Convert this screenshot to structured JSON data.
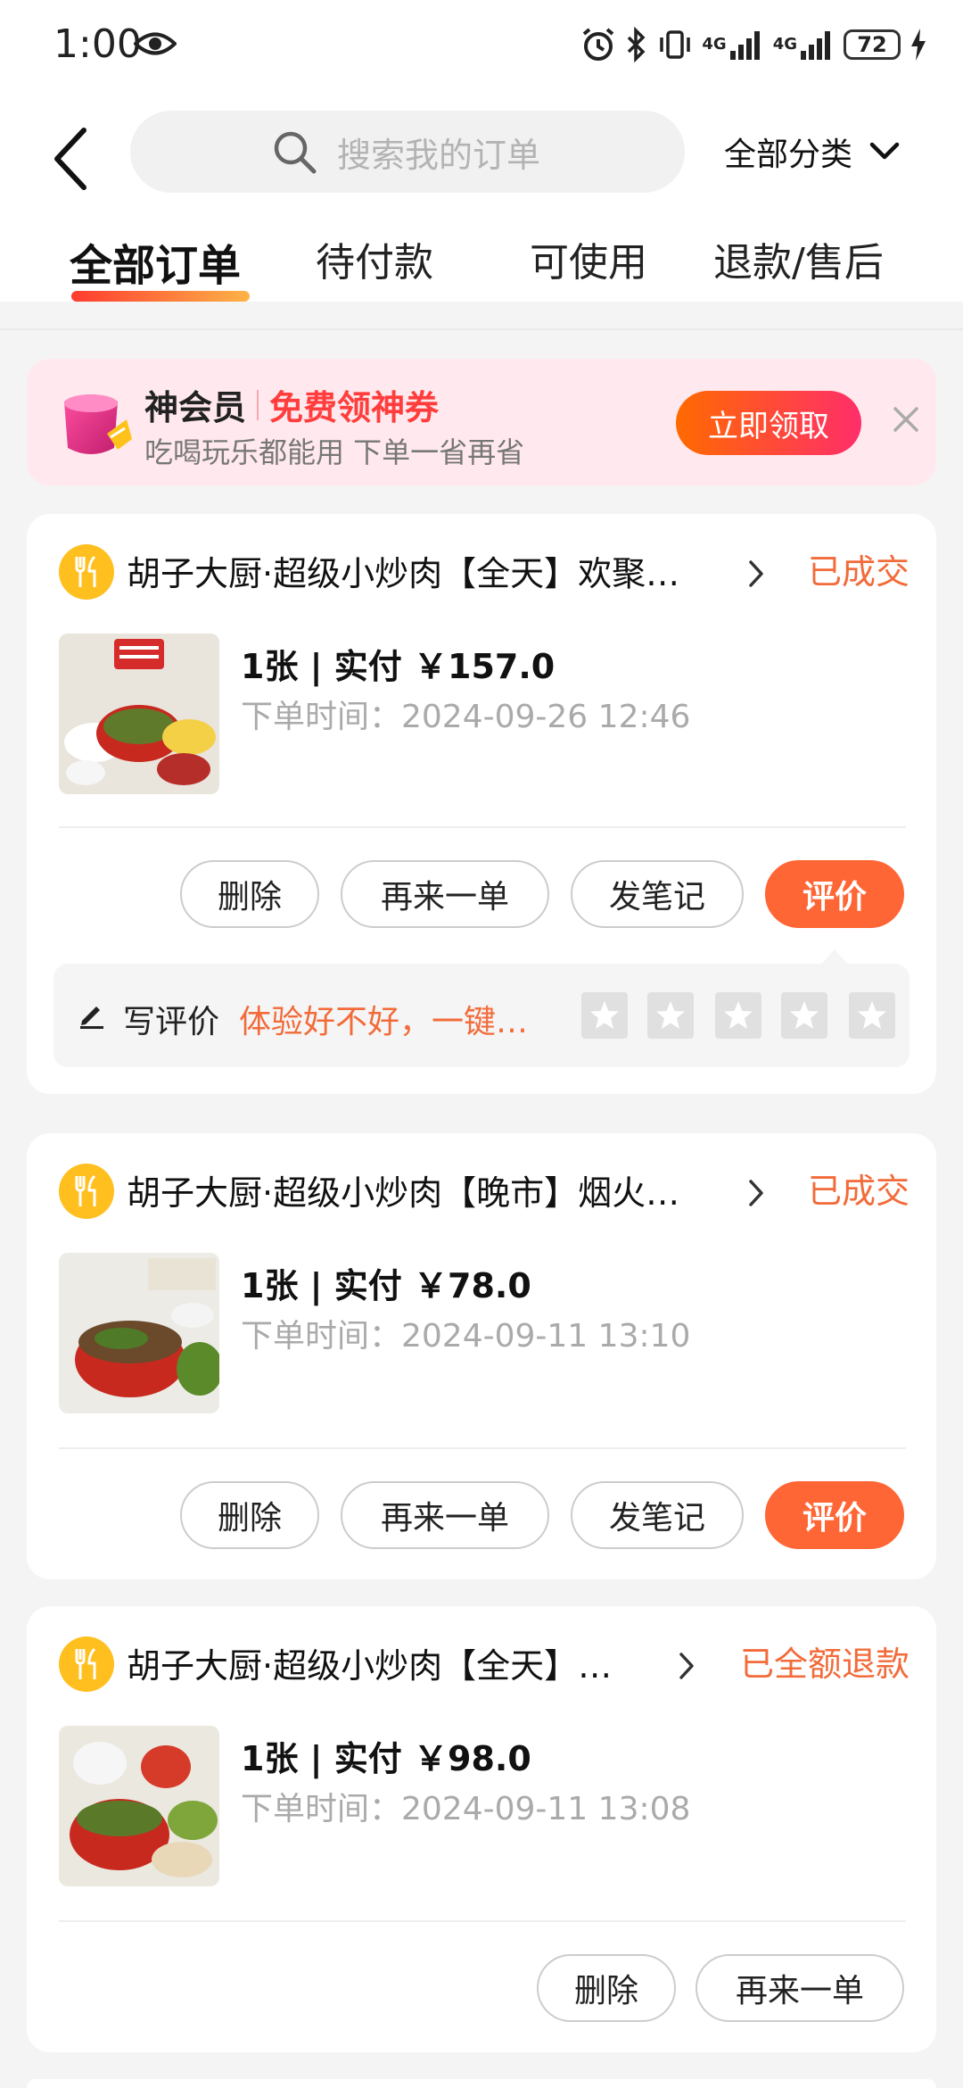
{
  "status_bar": {
    "time": "1:00",
    "battery": "72",
    "net1": "4G",
    "net2": "4G"
  },
  "search": {
    "placeholder": "搜索我的订单"
  },
  "category": {
    "label": "全部分类"
  },
  "tabs": [
    {
      "label": "全部订单",
      "active": true
    },
    {
      "label": "待付款",
      "active": false
    },
    {
      "label": "可使用",
      "active": false
    },
    {
      "label": "退款/售后",
      "active": false
    }
  ],
  "promo": {
    "title": "神会员",
    "highlight": "免费领神券",
    "subtitle": "吃喝玩乐都能用 下单一省再省",
    "button": "立即领取"
  },
  "orders": [
    {
      "shop": "胡子大厨·超级小炒肉【全天】欢聚…",
      "status": "已成交",
      "qty": "1张 | 实付 ￥157.0",
      "time": "下单时间：2024-09-26 12:46",
      "buttons": [
        "删除",
        "再来一单",
        "发笔记",
        "评价"
      ],
      "review": {
        "label": "写评价",
        "hint": "体验好不好，一键…"
      }
    },
    {
      "shop": "胡子大厨·超级小炒肉【晚市】烟火…",
      "status": "已成交",
      "qty": "1张 | 实付 ￥78.0",
      "time": "下单时间：2024-09-11 13:10",
      "buttons": [
        "删除",
        "再来一单",
        "发笔记",
        "评价"
      ]
    },
    {
      "shop": "胡子大厨·超级小炒肉【全天】…",
      "status": "已全额退款",
      "qty": "1张 | 实付 ￥98.0",
      "time": "下单时间：2024-09-11 13:08",
      "buttons": [
        "删除",
        "再来一单"
      ]
    }
  ],
  "colors": {
    "accent": "#ff6635",
    "status": "#f26b3a",
    "shop_icon": "#ffbf1f",
    "promo_bg": "#ffe9ee"
  },
  "icons": [
    "back-arrow-icon",
    "search-icon",
    "chevron-down-icon",
    "close-icon",
    "fork-knife-icon",
    "chevron-right-icon",
    "pen-icon",
    "star-icon"
  ]
}
